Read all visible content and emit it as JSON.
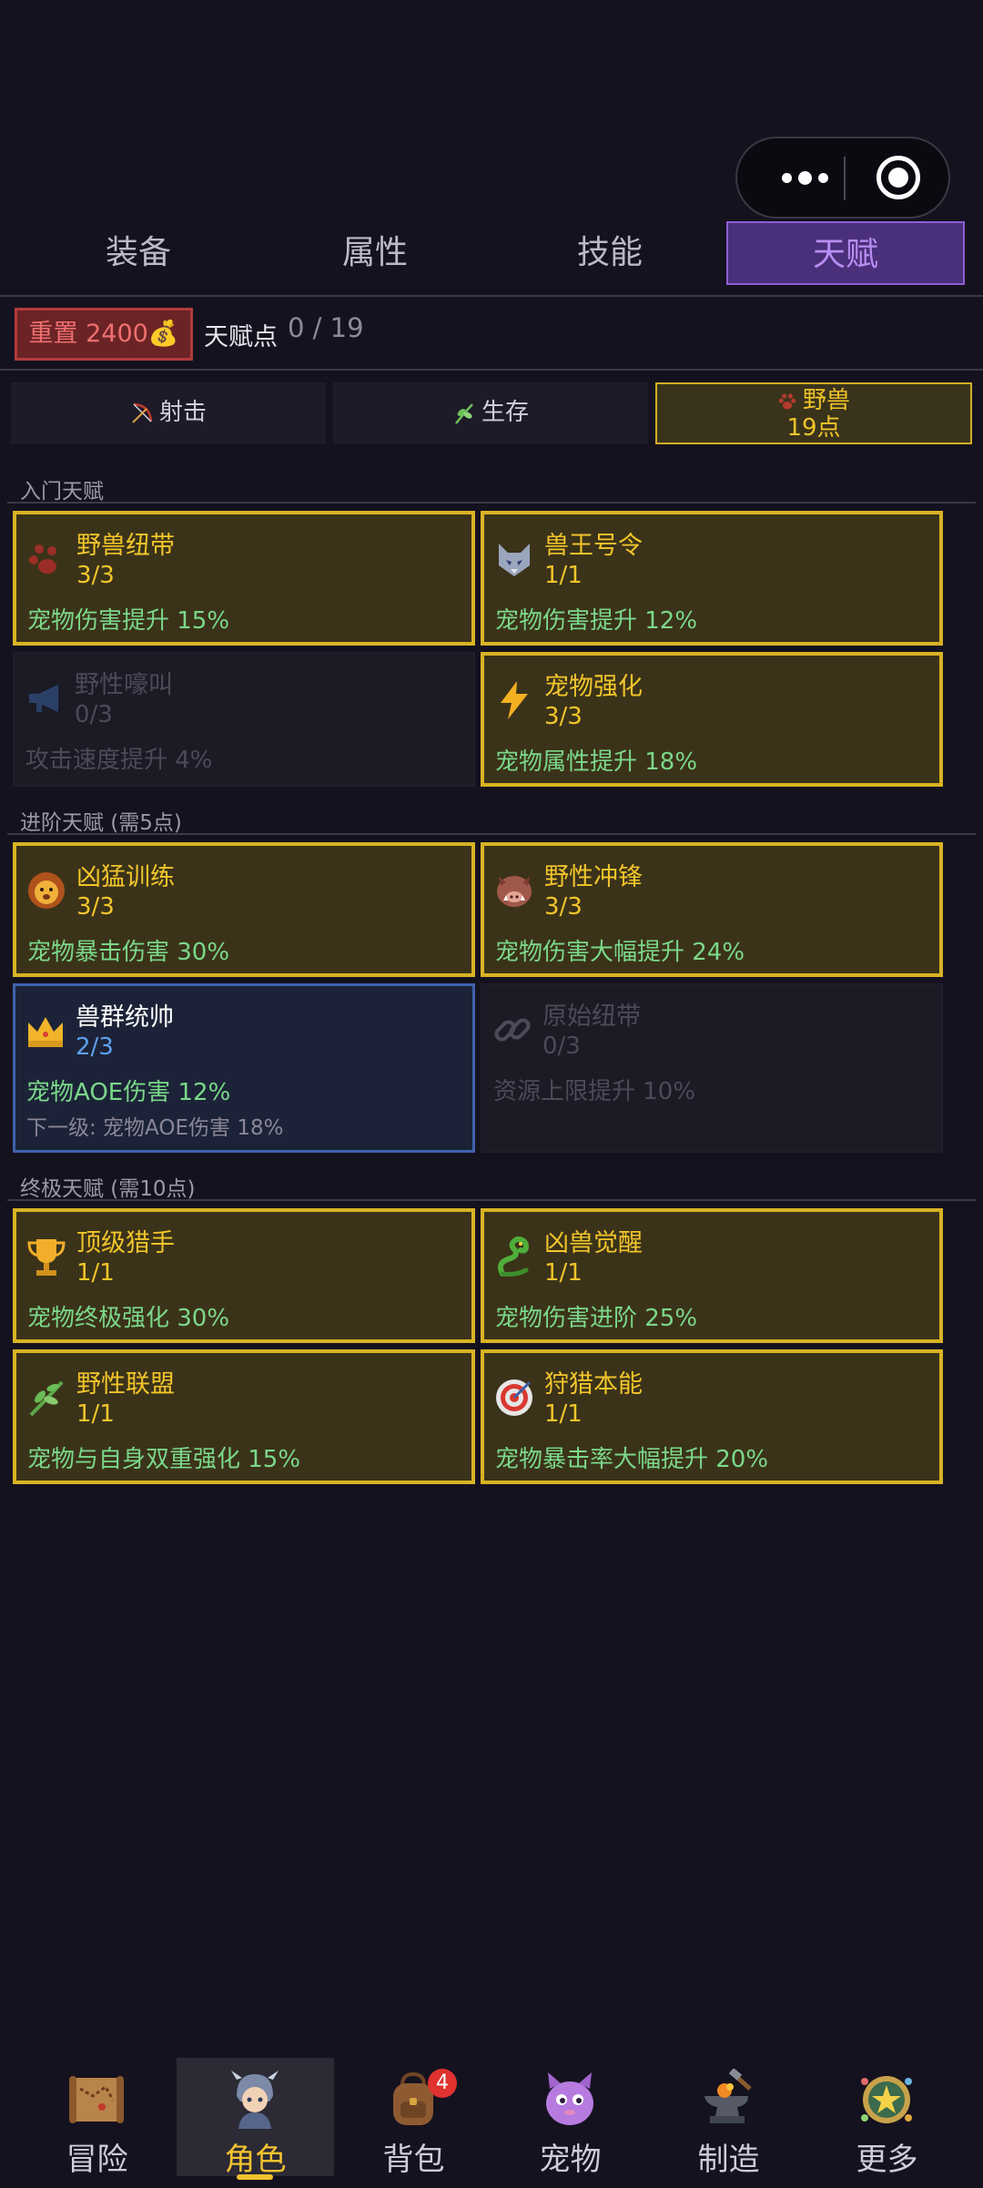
{
  "tabs": [
    "装备",
    "属性",
    "技能",
    "天赋"
  ],
  "reset": {
    "label": "重置 2400💰"
  },
  "talent_points": {
    "label": "天赋点",
    "value": "0 / 19"
  },
  "subtabs": {
    "shoot": "射击",
    "survive": "生存",
    "beast": {
      "label": "野兽",
      "points": "19点"
    }
  },
  "sections": [
    {
      "title": "入门天赋",
      "cards": [
        {
          "name": "野兽纽带",
          "level": "3/3",
          "desc": "宠物伤害提升 15%",
          "icon": "paw-icon",
          "state": "done"
        },
        {
          "name": "兽王号令",
          "level": "1/1",
          "desc": "宠物伤害提升 12%",
          "icon": "wolf-icon",
          "state": "done"
        },
        {
          "name": "野性嚎叫",
          "level": "0/3",
          "desc": "攻击速度提升 4%",
          "icon": "megaphone-icon",
          "state": "locked"
        },
        {
          "name": "宠物强化",
          "level": "3/3",
          "desc": "宠物属性提升 18%",
          "icon": "lightning-icon",
          "state": "done"
        }
      ]
    },
    {
      "title": "进阶天赋 (需5点)",
      "cards": [
        {
          "name": "凶猛训练",
          "level": "3/3",
          "desc": "宠物暴击伤害 30%",
          "icon": "lion-icon",
          "state": "done"
        },
        {
          "name": "野性冲锋",
          "level": "3/3",
          "desc": "宠物伤害大幅提升 24%",
          "icon": "boar-icon",
          "state": "done"
        },
        {
          "name": "兽群统帅",
          "level": "2/3",
          "desc": "宠物AOE伤害 12%",
          "next": "下一级: 宠物AOE伤害 18%",
          "icon": "crown-icon",
          "state": "partial"
        },
        {
          "name": "原始纽带",
          "level": "0/3",
          "desc": "资源上限提升 10%",
          "icon": "chain-icon",
          "state": "locked"
        }
      ]
    },
    {
      "title": "终极天赋 (需10点)",
      "cards": [
        {
          "name": "顶级猎手",
          "level": "1/1",
          "desc": "宠物终极强化 30%",
          "icon": "trophy-icon",
          "state": "done"
        },
        {
          "name": "凶兽觉醒",
          "level": "1/1",
          "desc": "宠物伤害进阶 25%",
          "icon": "dragon-icon",
          "state": "done"
        },
        {
          "name": "野性联盟",
          "level": "1/1",
          "desc": "宠物与自身双重强化 15%",
          "icon": "herb-icon",
          "state": "done"
        },
        {
          "name": "狩猎本能",
          "level": "1/1",
          "desc": "宠物暴击率大幅提升 20%",
          "icon": "target-icon",
          "state": "done"
        }
      ]
    }
  ],
  "bottom_nav": [
    {
      "label": "冒险",
      "icon": "map-scroll-icon"
    },
    {
      "label": "角色",
      "icon": "knight-avatar-icon",
      "active": true
    },
    {
      "label": "背包",
      "icon": "backpack-icon",
      "badge": "4"
    },
    {
      "label": "宠物",
      "icon": "pet-monster-icon"
    },
    {
      "label": "制造",
      "icon": "anvil-icon"
    },
    {
      "label": "更多",
      "icon": "star-badge-icon"
    }
  ]
}
